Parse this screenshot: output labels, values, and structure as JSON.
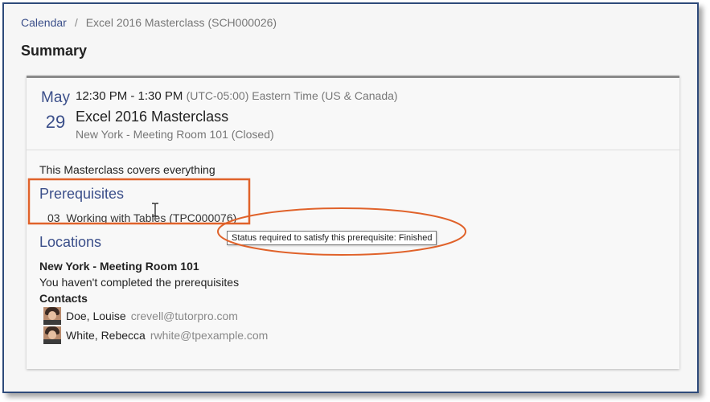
{
  "breadcrumb": {
    "link": "Calendar",
    "separator": "/",
    "current": "Excel 2016 Masterclass (SCH000026)"
  },
  "page_title": "Summary",
  "event": {
    "month": "May",
    "day": "29",
    "time": "12:30 PM - 1:30 PM",
    "timezone": "(UTC-05:00) Eastern Time (US & Canada)",
    "title": "Excel 2016 Masterclass",
    "location": "New York - Meeting Room 101 (Closed)",
    "description": "This Masterclass covers everything"
  },
  "prerequisites": {
    "heading": "Prerequisites",
    "items": [
      "03_Working with Tables (TPC000076)"
    ],
    "tooltip": "Status required to satisfy this prerequisite: Finished"
  },
  "locations": {
    "heading": "Locations",
    "name": "New York - Meeting Room 101",
    "message": "You haven't completed the prerequisites",
    "contacts_heading": "Contacts",
    "contacts": [
      {
        "name": "Doe, Louise",
        "email": "crevell@tutorpro.com"
      },
      {
        "name": "White, Rebecca",
        "email": "rwhite@tpexample.com"
      }
    ]
  },
  "colors": {
    "accent": "#3b4f8a",
    "annotation": "#e0622a",
    "frame_border": "#2e4a7a"
  },
  "icons": {
    "cursor": "text-cursor-icon",
    "avatar": "avatar"
  }
}
